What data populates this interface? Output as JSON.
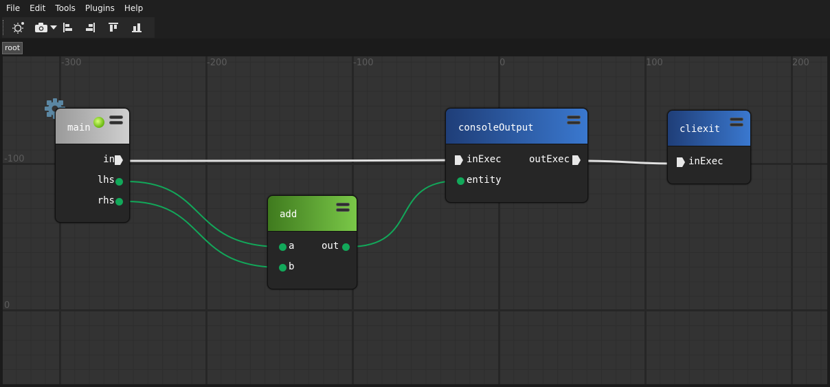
{
  "menu": [
    "File",
    "Edit",
    "Tools",
    "Plugins",
    "Help"
  ],
  "toolbar": {
    "icons": [
      "sun-settings-icon",
      "camera-icon",
      "align-left-icon",
      "align-right-icon",
      "align-top-icon",
      "align-bottom-icon"
    ]
  },
  "breadcrumb": {
    "root": "root"
  },
  "canvas": {
    "x_axis_labels": [
      "-300",
      "-200",
      "-100",
      "0",
      "100",
      "200"
    ],
    "y_axis_labels": [
      "-100",
      "0"
    ]
  },
  "nodes": {
    "main": {
      "title": "main",
      "ports": {
        "in": "in",
        "lhs": "lhs",
        "rhs": "rhs"
      },
      "header_color": "#a8a8a8"
    },
    "add": {
      "title": "add",
      "ports": {
        "a": "a",
        "b": "b",
        "out": "out"
      },
      "header_color": "#5fb035"
    },
    "consoleOutput": {
      "title": "consoleOutput",
      "ports": {
        "inExec": "inExec",
        "outExec": "outExec",
        "entity": "entity"
      },
      "header_color": "#2f60b5"
    },
    "cliexit": {
      "title": "cliexit",
      "ports": {
        "inExec": "inExec"
      },
      "header_color": "#2f60b5"
    }
  },
  "colors": {
    "wire_data": "#12a85a",
    "wire_exec": "#e0e0e0"
  }
}
